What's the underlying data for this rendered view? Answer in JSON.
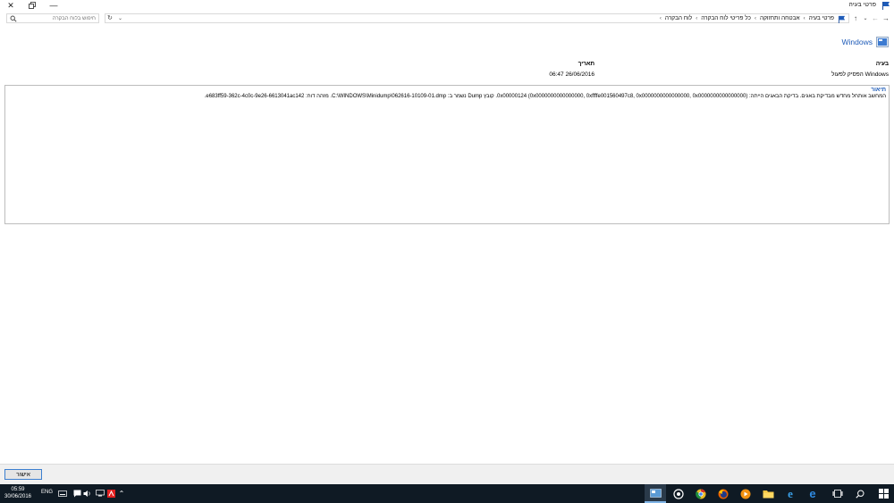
{
  "window": {
    "title": "פרטי בעיה"
  },
  "nav": {
    "breadcrumbs": [
      "לוח הבקרה",
      "כל פריטי לוח הבקרה",
      "אבטחה ותחזוקה",
      "פרטי בעיה"
    ],
    "search_placeholder": "חיפוש בלוח הבקרה"
  },
  "product": {
    "name": "Windows"
  },
  "problem": {
    "header": "בעיה",
    "value": "Windows הפסיק לפעול"
  },
  "date": {
    "header": "תאריך",
    "value": "26/06/2016 06:47"
  },
  "description": {
    "label": "תיאור",
    "text": "המחשב אותחל מחדש מבדיקת באגים. בדיקת הבאגים הייתה: 0x00000124 (0x0000000000000000, 0xffffe001560497c8, 0x0000000000000000, 0x0000000000000000). קובץ Dump נשמר ב: C:\\WINDOWS\\Minidump\\062616-10109-01.dmp. מזהה דוח: e683ff59-362c-4c0c-9e26-6613041ac142."
  },
  "footer": {
    "ok_label": "אישור"
  },
  "taskbar": {
    "time": "05:59",
    "date": "30/06/2016",
    "language": "ENG"
  },
  "colors": {
    "accent": "#1e5bb8",
    "taskbar": "#0f1a24",
    "footer_bg": "#f0f0f0"
  }
}
